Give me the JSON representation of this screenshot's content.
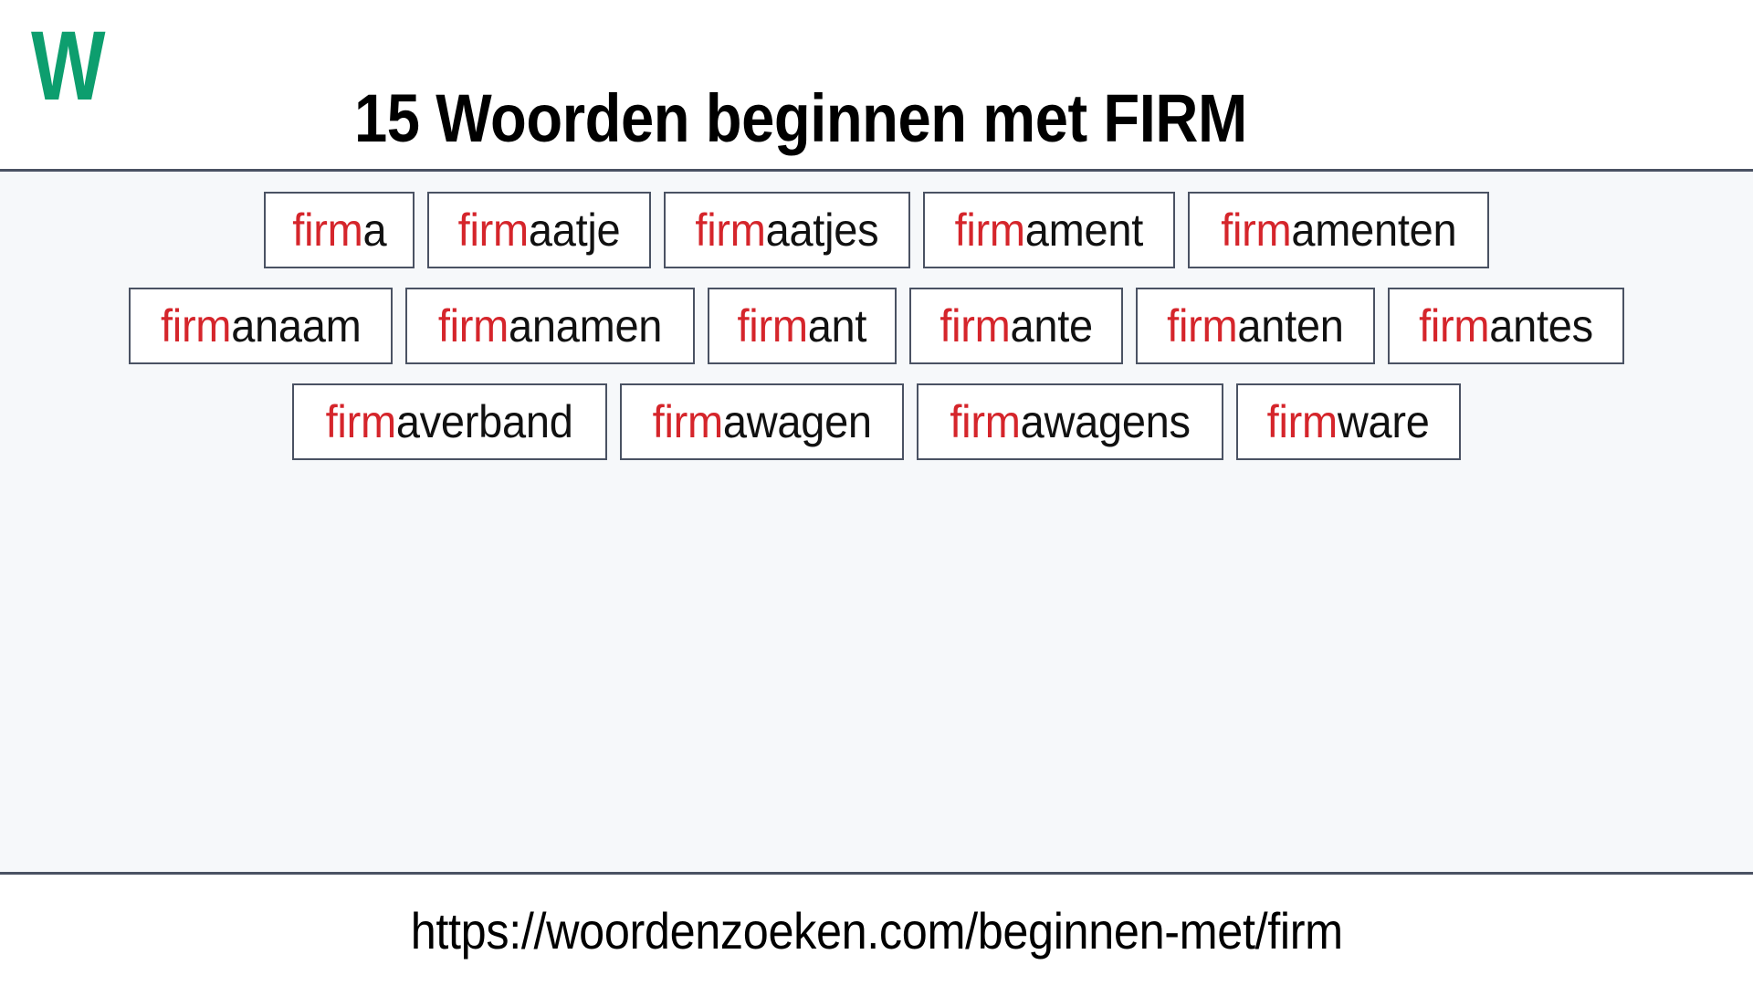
{
  "header": {
    "logo_text": "W",
    "logo_color": "#0d9e6e",
    "title": "15 Woorden beginnen met FIRM"
  },
  "theme": {
    "prefix_color": "#d5252b",
    "suffix_color": "#111111",
    "box_border_color": "#4a5263",
    "main_background": "#f6f8fa",
    "page_background": "#ffffff"
  },
  "main": {
    "highlight_prefix": "firm",
    "word_count": 15,
    "rows": [
      {
        "words": [
          {
            "prefix": "firm",
            "suffix": "a",
            "full": "firma"
          },
          {
            "prefix": "firm",
            "suffix": "aatje",
            "full": "firmaatje"
          },
          {
            "prefix": "firm",
            "suffix": "aatjes",
            "full": "firmaatjes"
          },
          {
            "prefix": "firm",
            "suffix": "ament",
            "full": "firmament"
          },
          {
            "prefix": "firm",
            "suffix": "amenten",
            "full": "firmamenten"
          }
        ]
      },
      {
        "words": [
          {
            "prefix": "firm",
            "suffix": "anaam",
            "full": "firmanaam"
          },
          {
            "prefix": "firm",
            "suffix": "anamen",
            "full": "firmanamen"
          },
          {
            "prefix": "firm",
            "suffix": "ant",
            "full": "firmant"
          },
          {
            "prefix": "firm",
            "suffix": "ante",
            "full": "firmante"
          },
          {
            "prefix": "firm",
            "suffix": "anten",
            "full": "firmanten"
          },
          {
            "prefix": "firm",
            "suffix": "antes",
            "full": "firmantes"
          }
        ]
      },
      {
        "words": [
          {
            "prefix": "firm",
            "suffix": "averband",
            "full": "firmaverband"
          },
          {
            "prefix": "firm",
            "suffix": "awagen",
            "full": "firmawagen"
          },
          {
            "prefix": "firm",
            "suffix": "awagens",
            "full": "firmawagens"
          },
          {
            "prefix": "firm",
            "suffix": "ware",
            "full": "firmware"
          }
        ]
      }
    ]
  },
  "footer": {
    "url": "https://woordenzoeken.com/beginnen-met/firm"
  }
}
